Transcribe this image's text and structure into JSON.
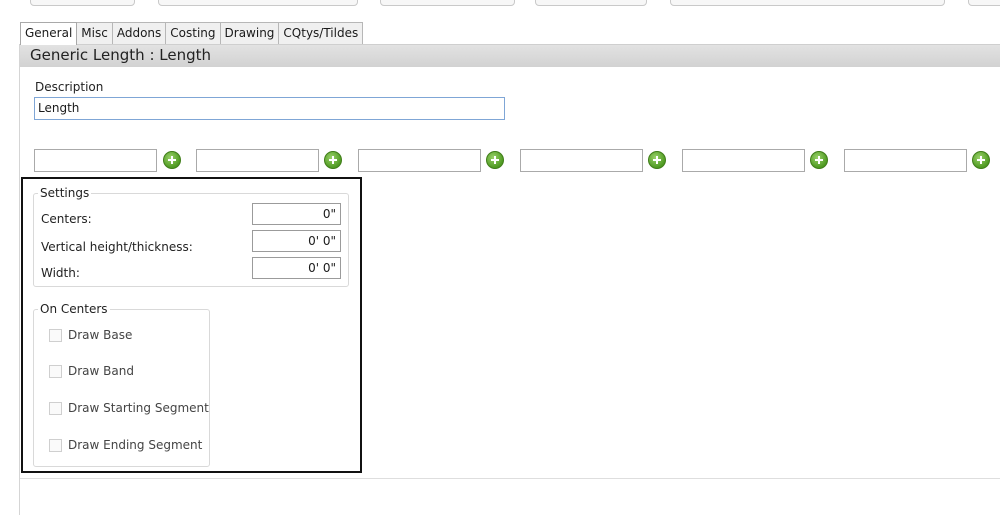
{
  "tabs": [
    "General",
    "Misc",
    "Addons",
    "Costing",
    "Drawing",
    "CQtys/Tildes"
  ],
  "active_tab": "General",
  "header": {
    "title": "Generic Length : Length"
  },
  "description": {
    "label": "Description",
    "value": "Length"
  },
  "add_icon": "plus-circle-icon",
  "settings": {
    "title": "Settings",
    "centers": {
      "label": "Centers:",
      "value": "0\""
    },
    "vertical": {
      "label": "Vertical height/thickness:",
      "value": "0' 0\""
    },
    "width": {
      "label": "Width:",
      "value": "0' 0\""
    }
  },
  "on_centers": {
    "title": "On Centers",
    "items": [
      "Draw Base",
      "Draw Band",
      "Draw Starting Segment",
      "Draw Ending Segment"
    ]
  },
  "colors": {
    "accent_border": "#7fa6d6",
    "add_green": "#4f9a22",
    "highlight": "#111111"
  }
}
